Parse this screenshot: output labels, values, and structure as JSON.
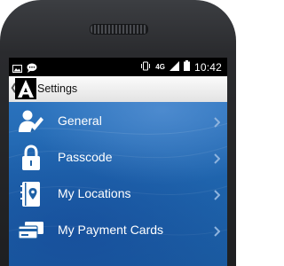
{
  "status_bar": {
    "left_icons": [
      "image-icon",
      "chat-icon"
    ],
    "right_icons": [
      "vibrate-icon",
      "network-4g-icon",
      "signal-icon",
      "battery-icon"
    ],
    "network": "4G",
    "time": "10:42"
  },
  "app_bar": {
    "back_icon": "chevron-left-icon",
    "logo": "app-logo",
    "title": "Settings"
  },
  "menu": {
    "items": [
      {
        "label": "General",
        "icon": "user-pen-icon"
      },
      {
        "label": "Passcode",
        "icon": "padlock-icon"
      },
      {
        "label": "My Locations",
        "icon": "address-book-icon"
      },
      {
        "label": "My Payment Cards",
        "icon": "payment-cards-icon"
      }
    ],
    "chevron_icon": "chevron-right-icon"
  },
  "colors": {
    "screen_blue": "#1d60a5",
    "chevron": "#8fb4de",
    "appbar": "#ececec"
  }
}
